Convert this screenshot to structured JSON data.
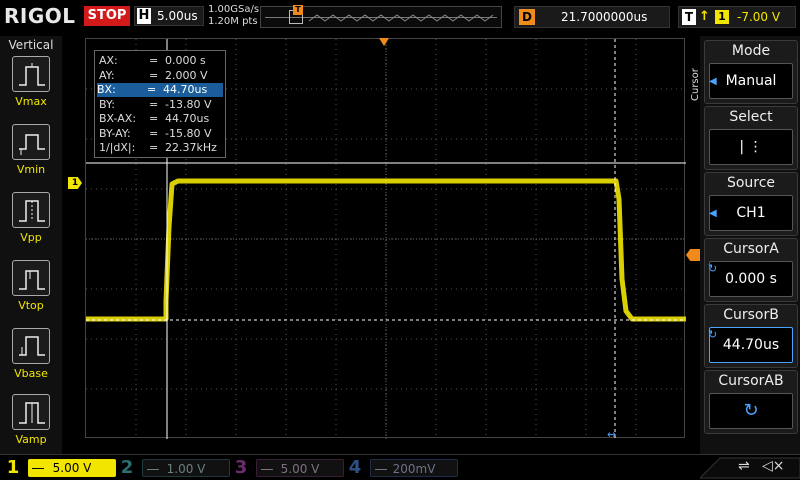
{
  "brand": "RIGOL",
  "run_state": "STOP",
  "timebase": {
    "label": "H",
    "value": "5.00us"
  },
  "sample": {
    "rate": "1.00GSa/s",
    "points": "1.20M pts"
  },
  "trigger_position_marker": "T",
  "delay": {
    "label": "D",
    "value": "21.7000000us"
  },
  "trigger": {
    "label": "T",
    "edge_icon": "rising-edge-icon",
    "edge_glyph": "↑",
    "channel": "1",
    "level": "-7.00 V"
  },
  "left_panel": {
    "title": "Vertical",
    "items": [
      {
        "label": "Vmax",
        "icon": "vmax-icon"
      },
      {
        "label": "Vmin",
        "icon": "vmin-icon"
      },
      {
        "label": "Vpp",
        "icon": "vpp-icon"
      },
      {
        "label": "Vtop",
        "icon": "vtop-icon"
      },
      {
        "label": "Vbase",
        "icon": "vbase-icon"
      },
      {
        "label": "Vamp",
        "icon": "vamp-icon"
      }
    ]
  },
  "cursor_info": {
    "rows": [
      {
        "k": "AX:",
        "eq": "=",
        "v": "0.000 s"
      },
      {
        "k": "AY:",
        "eq": "=",
        "v": "2.000 V"
      },
      {
        "k": "BX:",
        "eq": "=",
        "v": "44.70us"
      },
      {
        "k": "BY:",
        "eq": "=",
        "v": "-13.80 V"
      },
      {
        "k": "BX-AX:",
        "eq": "=",
        "v": "44.70us"
      },
      {
        "k": "BY-AY:",
        "eq": "=",
        "v": "-15.80 V"
      },
      {
        "k": "1/|dX|:",
        "eq": "=",
        "v": "22.37kHz"
      }
    ]
  },
  "ch1_marker": "1",
  "right_menu": {
    "tab": "Cursor",
    "items": [
      {
        "title": "Mode",
        "value": "Manual"
      },
      {
        "title": "Select",
        "value": "|   ⋮"
      },
      {
        "title": "Source",
        "value": "CH1"
      },
      {
        "title": "CursorA",
        "value": "0.000 s"
      },
      {
        "title": "CursorB",
        "value": "44.70us"
      },
      {
        "title": "CursorAB",
        "value": ""
      }
    ]
  },
  "channels": [
    {
      "num": "1",
      "value": "5.00 V",
      "color": "#f2e600"
    },
    {
      "num": "2",
      "value": "1.00 V",
      "color": "#00c8c8"
    },
    {
      "num": "3",
      "value": "5.00 V",
      "color": "#d23cd2"
    },
    {
      "num": "4",
      "value": "200mV",
      "color": "#2a7bff"
    }
  ],
  "colors": {
    "trace": "#f2e600",
    "accent": "#4aa3ff",
    "stop": "#d21a1a",
    "trigger": "#f08a1c"
  }
}
